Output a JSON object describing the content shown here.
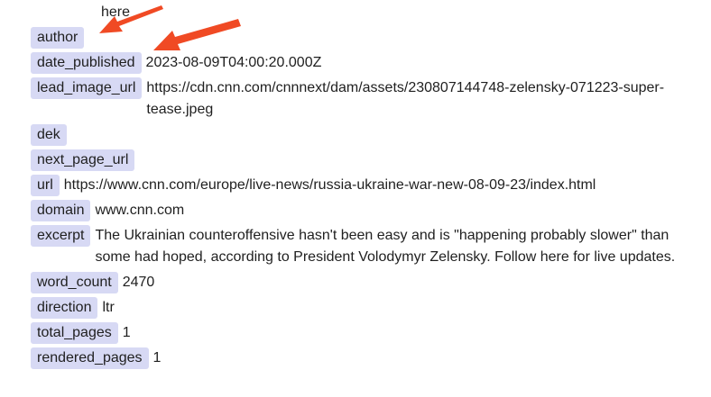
{
  "header_note": "here",
  "fields": [
    {
      "key": "author",
      "value": ""
    },
    {
      "key": "date_published",
      "value": "2023-08-09T04:00:20.000Z"
    },
    {
      "key": "lead_image_url",
      "value": "https://cdn.cnn.com/cnnnext/dam/assets/230807144748-zelensky-071223-super-tease.jpeg"
    },
    {
      "key": "dek",
      "value": ""
    },
    {
      "key": "next_page_url",
      "value": ""
    },
    {
      "key": "url",
      "value": "https://www.cnn.com/europe/live-news/russia-ukraine-war-new-08-09-23/index.html"
    },
    {
      "key": "domain",
      "value": "www.cnn.com"
    },
    {
      "key": "excerpt",
      "value": "The Ukrainian counteroffensive hasn't been easy and is \"happening probably slower\" than some had hoped, according to President Volodymyr Zelensky. Follow here for live updates."
    },
    {
      "key": "word_count",
      "value": "2470"
    },
    {
      "key": "direction",
      "value": "ltr"
    },
    {
      "key": "total_pages",
      "value": "1"
    },
    {
      "key": "rendered_pages",
      "value": "1"
    }
  ],
  "colors": {
    "key_background": "#d7d9f4",
    "annotation_arrow": "#f04a24"
  }
}
